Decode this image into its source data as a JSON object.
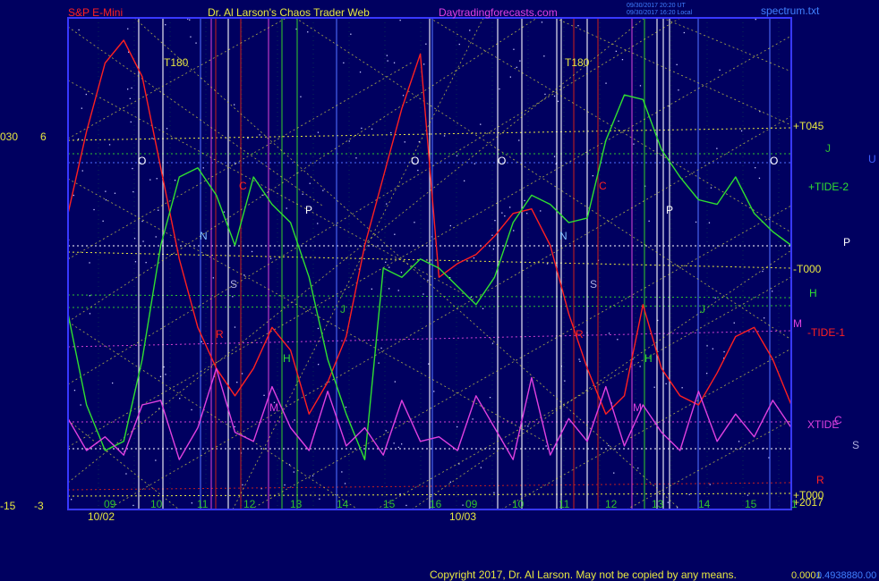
{
  "header": {
    "product": "S&P E-Mini",
    "title": "Dr. Al Larson's Chaos Trader Web",
    "site": "Daytradingforecasts.com",
    "stamp1": "09/30/2017 20:20 UT",
    "stamp2": "09/30/2017 16:20 Local",
    "file": "spectrum.txt"
  },
  "footer": {
    "copyright": "Copyright 2017, Dr. Al Larson. May not be copied by any means.",
    "code": "0.0001",
    "code2": "0.4938880.00"
  },
  "colors": {
    "background": "#000060",
    "frame": "#3838ff",
    "price": "#ff2020",
    "tide": "#30e030",
    "xtide": "#e040e0",
    "grid_yellow": "#e8e840",
    "white": "#ffffff",
    "blue_line": "#5070ff",
    "magenta_line": "#d040d0",
    "green_line": "#30c030",
    "red_line": "#c02020"
  },
  "chart_data": {
    "type": "line",
    "date_labels": [
      "10/02",
      "10/03"
    ],
    "hour_labels": [
      {
        "day": 0,
        "labels": [
          "09",
          "10",
          "11",
          "12",
          "13",
          "14",
          "15",
          "16"
        ]
      },
      {
        "day": 1,
        "labels": [
          "09",
          "10",
          "11",
          "12",
          "13",
          "14",
          "15",
          "1"
        ]
      }
    ],
    "y_scale_left": {
      "outer_top": "030",
      "inner_top": "6",
      "outer_bottom": "-15",
      "inner_bottom": "-3"
    },
    "right_labels": [
      "+T045",
      "J",
      "U",
      "+TIDE-2",
      "P",
      "-T000",
      "H",
      "M",
      "-TIDE-1",
      "XTIDE",
      "C",
      "S",
      "R",
      "+T000",
      "+2017"
    ],
    "vertical_markers": [
      "T180",
      "T180"
    ],
    "series": [
      {
        "name": "S&P E-Mini",
        "color": "price",
        "values": [
          0.62,
          0.8,
          0.95,
          1.0,
          0.92,
          0.72,
          0.52,
          0.37,
          0.28,
          0.22,
          0.28,
          0.37,
          0.32,
          0.18,
          0.25,
          0.35,
          0.55,
          0.7,
          0.85,
          0.97,
          0.48,
          0.51,
          0.53,
          0.57,
          0.62,
          0.63,
          0.55,
          0.4,
          0.28,
          0.18,
          0.22,
          0.42,
          0.28,
          0.22,
          0.2,
          0.27,
          0.35,
          0.37,
          0.3,
          0.2
        ]
      },
      {
        "name": "TIDE",
        "color": "tide",
        "values": [
          0.4,
          0.2,
          0.1,
          0.12,
          0.3,
          0.55,
          0.7,
          0.72,
          0.66,
          0.55,
          0.7,
          0.64,
          0.6,
          0.48,
          0.3,
          0.18,
          0.08,
          0.5,
          0.48,
          0.52,
          0.5,
          0.46,
          0.42,
          0.48,
          0.6,
          0.66,
          0.64,
          0.6,
          0.61,
          0.78,
          0.88,
          0.87,
          0.76,
          0.7,
          0.65,
          0.64,
          0.7,
          0.62,
          0.58,
          0.55
        ]
      },
      {
        "name": "XTIDE",
        "color": "xtide",
        "values": [
          0.17,
          0.1,
          0.13,
          0.09,
          0.2,
          0.21,
          0.08,
          0.15,
          0.28,
          0.14,
          0.12,
          0.24,
          0.15,
          0.1,
          0.23,
          0.11,
          0.15,
          0.09,
          0.21,
          0.12,
          0.13,
          0.1,
          0.22,
          0.15,
          0.08,
          0.26,
          0.09,
          0.17,
          0.12,
          0.24,
          0.11,
          0.2,
          0.14,
          0.1,
          0.23,
          0.12,
          0.18,
          0.13,
          0.21,
          0.15
        ]
      }
    ],
    "grid": true
  }
}
